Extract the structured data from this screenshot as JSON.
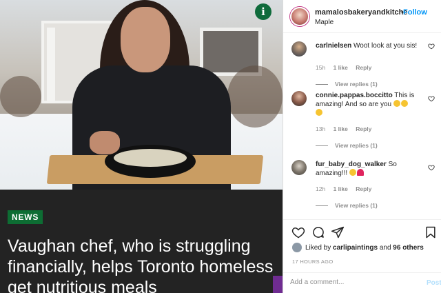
{
  "article": {
    "category_label": "NEWS",
    "headline": "Vaughan chef, who is struggling financially, helps Toronto homeless get nutritious meals",
    "info_icon_glyph": "i",
    "accent_color": "#0d6d33"
  },
  "post": {
    "username": "mamalosbakeryandkitche",
    "separator": "•",
    "follow_label": "Follow",
    "location": "Maple",
    "follow_color": "#0095f6"
  },
  "comments": [
    {
      "username": "carlnielsen",
      "text": "Woot look at you sis!",
      "time": "15h",
      "likes": "1 like",
      "reply_label": "Reply",
      "view_replies": "View replies (1)",
      "avatar_icon": "avatar-icon"
    },
    {
      "username": "connie.pappas.boccitto",
      "text": "This is amazing! And so are you",
      "time": "13h",
      "likes": "1 like",
      "reply_label": "Reply",
      "view_replies": "View replies (1)",
      "avatar_icon": "avatar-icon"
    },
    {
      "username": "fur_baby_dog_walker",
      "text": "So amazing!!!",
      "time": "12h",
      "likes": "1 like",
      "reply_label": "Reply",
      "view_replies": "View replies (1)",
      "avatar_icon": "avatar-icon"
    }
  ],
  "actions": {
    "icons": [
      "heart-icon",
      "comment-icon",
      "share-icon",
      "bookmark-icon"
    ]
  },
  "likes": {
    "prefix": "Liked by",
    "user": "carlipaintings",
    "conjunction": "and",
    "others": "96 others"
  },
  "timestamp": "17 HOURS AGO",
  "comment_box": {
    "placeholder": "Add a comment...",
    "post_label": "Post"
  }
}
